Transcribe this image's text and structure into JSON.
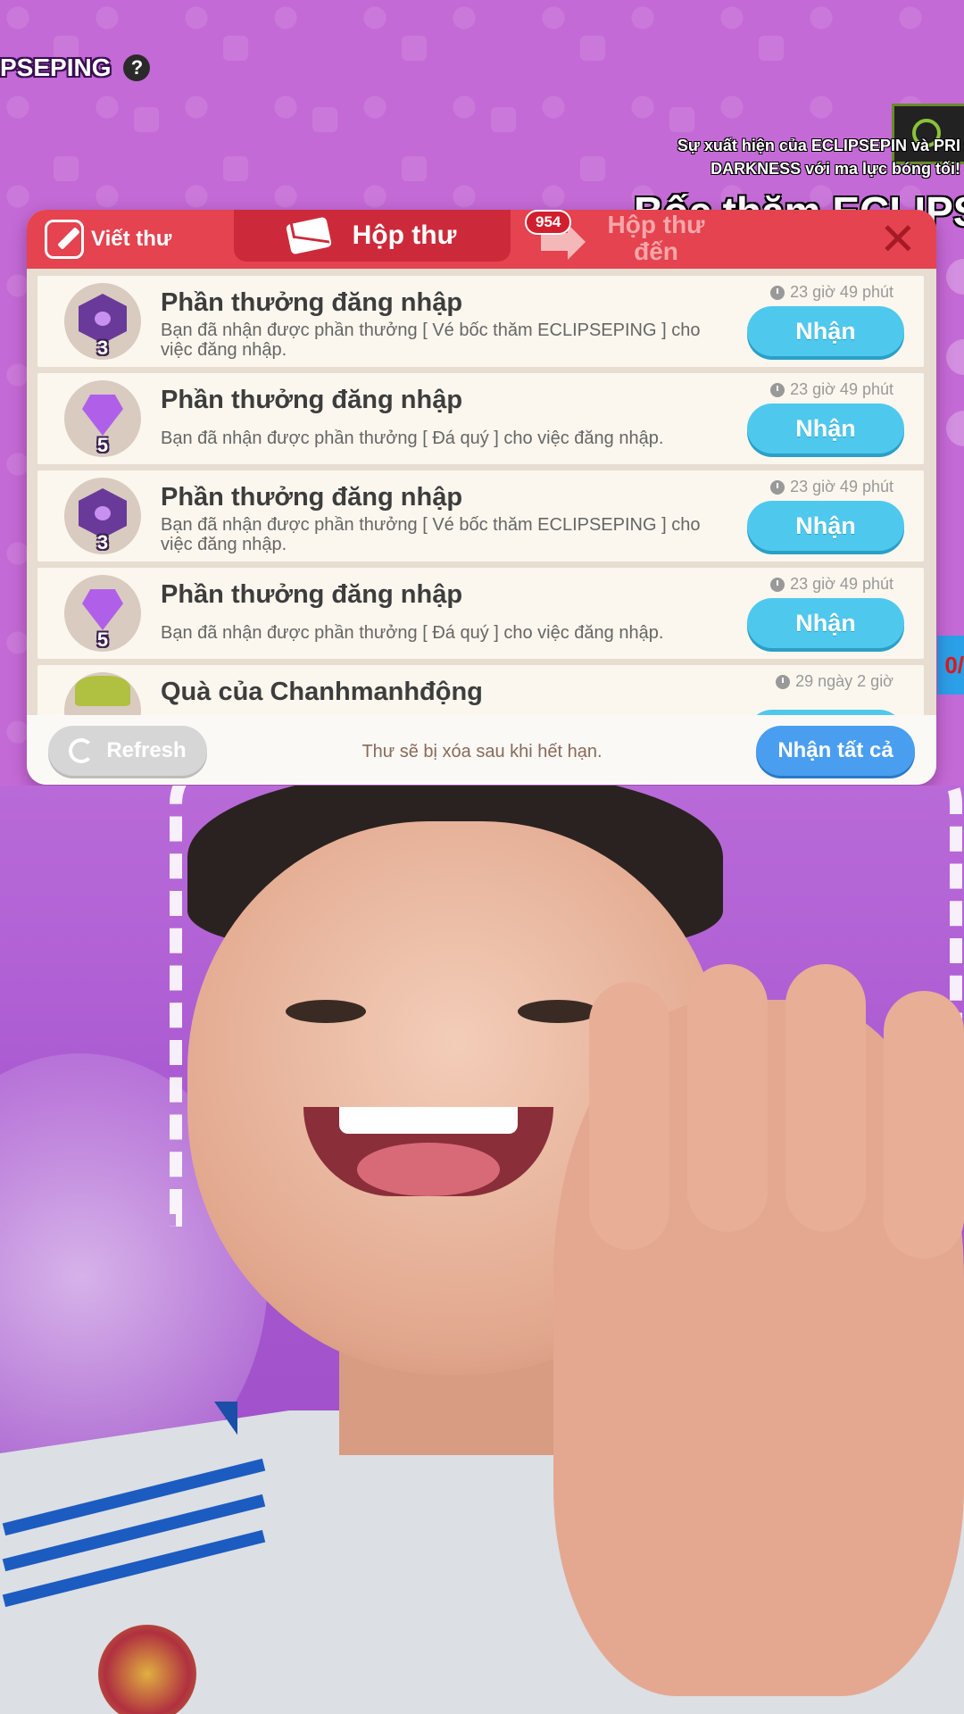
{
  "game": {
    "top_title": "PSEPING",
    "help_icon": "?",
    "announcement_line1": "Sự xuất hiện của ECLIPSEPIN",
    "announcement_line1_tail": "và PRI",
    "announcement_line2": "DARKNESS với ma lực bóng tối!",
    "event_banner": "Bốc thăm ECLIPSEP",
    "side_tag": "0/"
  },
  "mailbox": {
    "tabs": {
      "write": "Viết thư",
      "inbox": "Hộp thư",
      "sent_badge": "954",
      "sent": "Hộp thư đến"
    },
    "items": [
      {
        "title": "Phần thưởng đăng nhập",
        "desc": "Bạn đã nhận được phần thưởng [ Vé bốc thăm ECLIPSEPING ] cho việc đăng nhập.",
        "time": "23 giờ 49 phút",
        "count": "3",
        "icon": "ticket-icon",
        "button": "Nhận"
      },
      {
        "title": "Phần thưởng đăng nhập",
        "desc": "Bạn đã nhận được phần thưởng [ Đá quý ] cho việc đăng nhập.",
        "time": "23 giờ 49 phút",
        "count": "5",
        "icon": "gem-icon",
        "button": "Nhận"
      },
      {
        "title": "Phần thưởng đăng nhập",
        "desc": "Bạn đã nhận được phần thưởng [ Vé bốc thăm ECLIPSEPING ] cho việc đăng nhập.",
        "time": "23 giờ 49 phút",
        "count": "3",
        "icon": "ticket-icon",
        "button": "Nhận"
      },
      {
        "title": "Phần thưởng đăng nhập",
        "desc": "Bạn đã nhận được phần thưởng [ Đá quý ] cho việc đăng nhập.",
        "time": "23 giờ 49 phút",
        "count": "5",
        "icon": "gem-icon",
        "button": "Nhận"
      },
      {
        "title": "Quà của Chanhmanhđộng",
        "desc": "",
        "time": "29 ngày 2 giờ",
        "count": "",
        "icon": "grape-icon",
        "button": ""
      }
    ],
    "footer": {
      "refresh": "Refresh",
      "note": "Thư sẽ bị xóa sau khi hết hạn.",
      "claim_all": "Nhận tất cả"
    }
  },
  "colors": {
    "header_red": "#e4434f",
    "claim_blue": "#4fc8ee",
    "claim_all_blue": "#4a9ef0",
    "background_purple": "#c46ad6"
  }
}
